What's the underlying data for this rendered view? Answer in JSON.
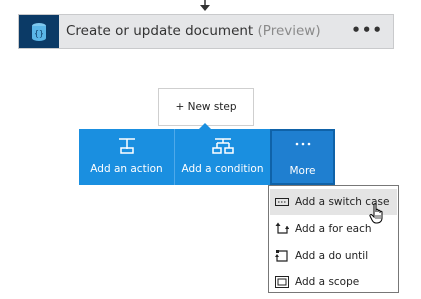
{
  "action_card": {
    "title": "Create or update document",
    "preview_tag": "(Preview)",
    "more_label": "•••",
    "icon": "database-icon",
    "icon_color": "#0b3a66"
  },
  "new_step": {
    "label": "+ New step"
  },
  "step_buttons": [
    {
      "label": "Add an action",
      "icon": "action-icon"
    },
    {
      "label": "Add a condition",
      "icon": "condition-icon"
    },
    {
      "label": "More",
      "icon": "ellipsis-icon"
    }
  ],
  "more_menu": {
    "items": [
      {
        "label": "Add a switch case",
        "icon": "switch-case-icon",
        "highlighted": true
      },
      {
        "label": "Add a for each",
        "icon": "for-each-icon"
      },
      {
        "label": "Add a do until",
        "icon": "do-until-icon"
      },
      {
        "label": "Add a scope",
        "icon": "scope-icon"
      }
    ]
  },
  "colors": {
    "accent": "#1a8fe0",
    "card_bg": "#e5e6e8",
    "menu_highlight": "#e4e4e4"
  }
}
